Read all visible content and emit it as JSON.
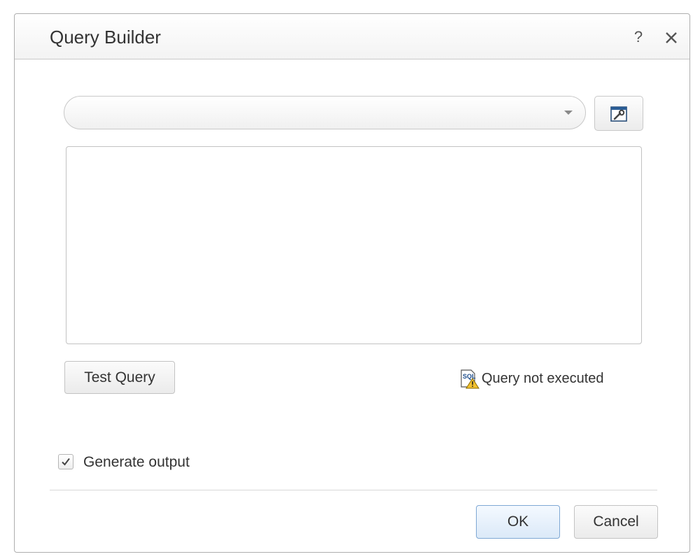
{
  "dialog": {
    "title": "Query Builder",
    "help_label": "?"
  },
  "query_select": {
    "value": ""
  },
  "query_text": {
    "value": ""
  },
  "test_query": {
    "label": "Test Query"
  },
  "status": {
    "text": "Query not executed",
    "icon": "sql-warning-icon"
  },
  "generate_output": {
    "label": "Generate output",
    "checked": true
  },
  "footer": {
    "ok_label": "OK",
    "cancel_label": "Cancel"
  },
  "colors": {
    "ok_border": "#7fa8d4",
    "warning": "#f2c12e"
  }
}
